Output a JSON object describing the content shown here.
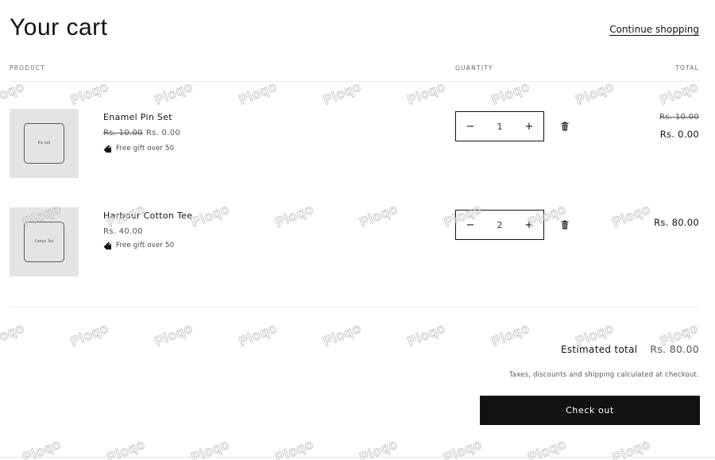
{
  "header": {
    "title": "Your cart",
    "continue_label": "Continue shopping"
  },
  "columns": {
    "product": "PRODUCT",
    "quantity": "QUANTITY",
    "total": "TOTAL"
  },
  "items": [
    {
      "thumb_text": "Pin Set",
      "name": "Enamel Pin Set",
      "price_old": "Rs. 10.00",
      "price_new": "Rs. 0.00",
      "gift": "Free gift over 50",
      "qty_minus": "−",
      "quantity": "1",
      "qty_plus": "+",
      "total_old": "Rs. 10.00",
      "total_new": "Rs. 0.00"
    },
    {
      "thumb_text": "Cotton Tee",
      "name": "Harbour Cotton Tee",
      "price": "Rs. 40.00",
      "gift": "Free gift over 50",
      "qty_minus": "−",
      "quantity": "2",
      "qty_plus": "+",
      "total": "Rs. 80.00"
    }
  ],
  "summary": {
    "estimated_label": "Estimated total",
    "estimated_value": "Rs. 80.00",
    "tax_note": "Taxes, discounts and shipping calculated at checkout.",
    "checkout_label": "Check out"
  },
  "watermark": {
    "text": "Ploqo"
  },
  "icons": {
    "tag": "tag-icon",
    "trash": "trash-icon"
  }
}
